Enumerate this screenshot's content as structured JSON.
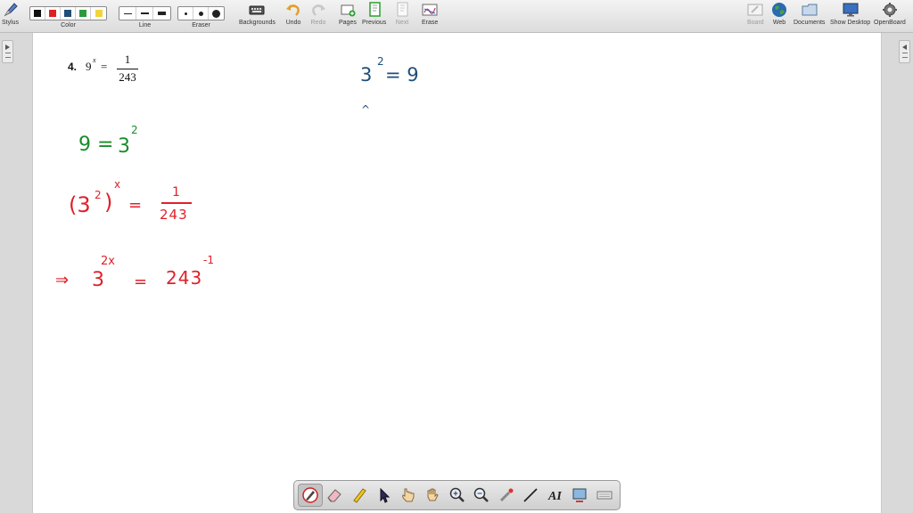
{
  "toolbar": {
    "stylus": "Stylus",
    "color": "Color",
    "line": "Line",
    "eraser": "Eraser",
    "backgrounds": "Backgrounds",
    "undo": "Undo",
    "redo": "Redo",
    "pages": "Pages",
    "previous": "Previous",
    "next": "Next",
    "erase": "Erase",
    "board": "Board",
    "web": "Web",
    "documents": "Documents",
    "show_desktop": "Show Desktop",
    "openboard": "OpenBoard",
    "palette_colors": [
      "#111111",
      "#e02020",
      "#1f4e79",
      "#2a9a3a",
      "#f2d33a"
    ]
  },
  "problem": {
    "number": "4.",
    "base": "9",
    "exponent": "x",
    "equals": "=",
    "numerator": "1",
    "denominator": "243"
  },
  "ink": {
    "blue_base": "3",
    "blue_exp": "2",
    "blue_rest": "= 9",
    "blue_mark": "^",
    "green_lhs": "9 =",
    "green_base": "3",
    "green_exp": "2",
    "red1_open": "(3",
    "red1_inner_exp": "2",
    "red1_close": ")",
    "red1_outer_exp": "x",
    "red1_eq": "=",
    "red1_num": "1",
    "red1_den": "243",
    "red2_arrow": "⇒",
    "red2_base": "3",
    "red2_exp": "2x",
    "red2_eq": "=",
    "red2_rhs": "243",
    "red2_rhs_exp": "-1"
  }
}
